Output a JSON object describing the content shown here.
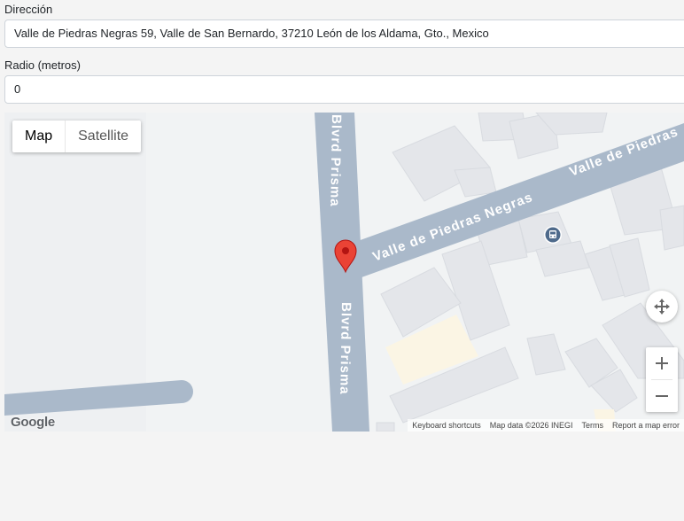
{
  "form": {
    "address_label": "Dirección",
    "address_value": "Valle de Piedras Negras 59, Valle de San Bernardo, 37210 León de los Aldama, Gto., Mexico",
    "radius_label": "Radio (metros)",
    "radius_value": "0"
  },
  "map": {
    "type_map": "Map",
    "type_satellite": "Satellite",
    "street_vertical": "Blvrd Prisma",
    "street_diagonal": "Valle de Piedras Negras",
    "street_diagonal_2": "Valle de Piedras",
    "logo": "Google",
    "footer": {
      "shortcuts": "Keyboard shortcuts",
      "attribution": "Map data ©2026 INEGI",
      "terms": "Terms",
      "report": "Report a map error"
    },
    "colors": {
      "road": "#aab9ca",
      "block": "#e8eaed",
      "park": "#fbf5e4",
      "marker": "#ea4335"
    },
    "icons": {
      "marker": "map-pin-icon",
      "transit": "bus-icon",
      "fullscreen": "fullscreen-icon"
    }
  }
}
